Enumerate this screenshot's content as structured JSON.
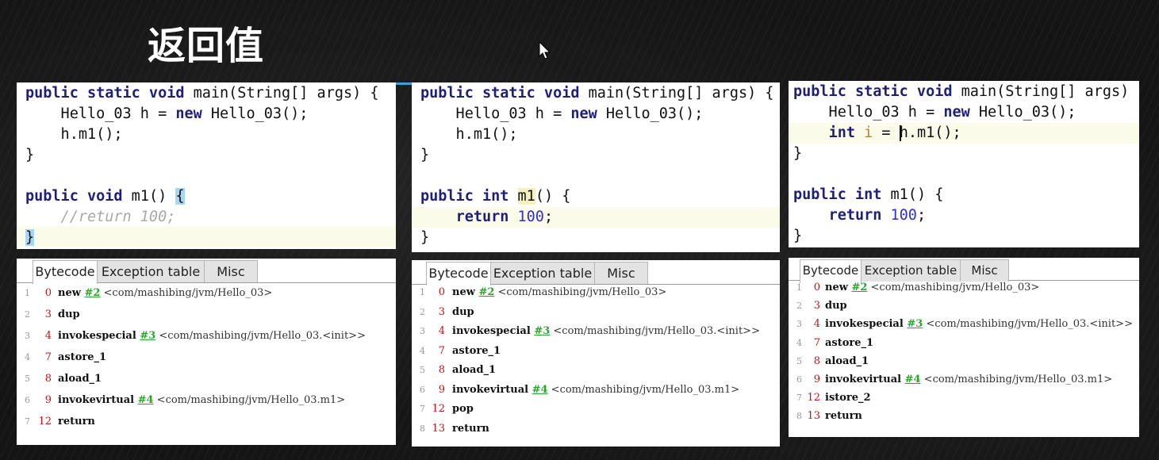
{
  "slide": {
    "title": "返回值"
  },
  "panels": [
    {
      "code": {
        "line1_kw": "public static void",
        "line1_rest": " main(String[] args) {",
        "line2_pre": "    Hello_03 h = ",
        "line2_kw": "new",
        "line2_post": " Hello_03();",
        "line3": "    h.m1();",
        "line4": "}",
        "line6_kw": "public void",
        "line6_mid": " m1() ",
        "line6_brace": "{",
        "line7": "    //return 100;",
        "line8_brace": "}"
      },
      "tabs": [
        "Bytecode",
        "Exception table",
        "Misc"
      ],
      "bytecode": [
        {
          "ln": "1",
          "off": "0",
          "op": "new",
          "ref": "#2",
          "arg": " <com/mashibing/jvm/Hello_03>"
        },
        {
          "ln": "2",
          "off": "3",
          "op": "dup",
          "ref": "",
          "arg": ""
        },
        {
          "ln": "3",
          "off": "4",
          "op": "invokespecial",
          "ref": "#3",
          "arg": " <com/mashibing/jvm/Hello_03.<init>>"
        },
        {
          "ln": "4",
          "off": "7",
          "op": "astore_1",
          "ref": "",
          "arg": ""
        },
        {
          "ln": "5",
          "off": "8",
          "op": "aload_1",
          "ref": "",
          "arg": ""
        },
        {
          "ln": "6",
          "off": "9",
          "op": "invokevirtual",
          "ref": "#4",
          "arg": " <com/mashibing/jvm/Hello_03.m1>"
        },
        {
          "ln": "7",
          "off": "12",
          "op": "return",
          "ref": "",
          "arg": ""
        }
      ]
    },
    {
      "code": {
        "line1_kw": "public static void",
        "line1_rest": " main(String[] args) {",
        "line2_pre": "    Hello_03 h = ",
        "line2_kw": "new",
        "line2_post": " Hello_03();",
        "line3": "    h.m1();",
        "line4": "}",
        "line6_kw": "public int",
        "line6_name": "m1",
        "line6_rest": "() {",
        "line7_kw": "return",
        "line7_num": "100",
        "line7_end": ";",
        "line8": "}"
      },
      "tabs": [
        "Bytecode",
        "Exception table",
        "Misc"
      ],
      "bytecode": [
        {
          "ln": "1",
          "off": "0",
          "op": "new",
          "ref": "#2",
          "arg": " <com/mashibing/jvm/Hello_03>"
        },
        {
          "ln": "2",
          "off": "3",
          "op": "dup",
          "ref": "",
          "arg": ""
        },
        {
          "ln": "3",
          "off": "4",
          "op": "invokespecial",
          "ref": "#3",
          "arg": " <com/mashibing/jvm/Hello_03.<init>>"
        },
        {
          "ln": "4",
          "off": "7",
          "op": "astore_1",
          "ref": "",
          "arg": ""
        },
        {
          "ln": "5",
          "off": "8",
          "op": "aload_1",
          "ref": "",
          "arg": ""
        },
        {
          "ln": "6",
          "off": "9",
          "op": "invokevirtual",
          "ref": "#4",
          "arg": " <com/mashibing/jvm/Hello_03.m1>"
        },
        {
          "ln": "7",
          "off": "12",
          "op": "pop",
          "ref": "",
          "arg": ""
        },
        {
          "ln": "8",
          "off": "13",
          "op": "return",
          "ref": "",
          "arg": ""
        }
      ]
    },
    {
      "code": {
        "line1_kw": "public static void",
        "line1_rest": " main(String[] args) {",
        "line2_pre": "    Hello_03 h = ",
        "line2_kw": "new",
        "line2_post": " Hello_03();",
        "line3_kw": "int",
        "line3_var": "i",
        "line3_eq": " = ",
        "line3_post": "h.m1();",
        "line4": "}",
        "line6_kw": "public int",
        "line6_rest": " m1() {",
        "line7_kw": "return",
        "line7_num": "100",
        "line7_end": ";",
        "line8": "}"
      },
      "tabs": [
        "Bytecode",
        "Exception table",
        "Misc"
      ],
      "bytecode": [
        {
          "ln": "1",
          "off": "0",
          "op": "new",
          "ref": "#2",
          "arg": " <com/mashibing/jvm/Hello_03>"
        },
        {
          "ln": "2",
          "off": "3",
          "op": "dup",
          "ref": "",
          "arg": ""
        },
        {
          "ln": "3",
          "off": "4",
          "op": "invokespecial",
          "ref": "#3",
          "arg": " <com/mashibing/jvm/Hello_03.<init>>"
        },
        {
          "ln": "4",
          "off": "7",
          "op": "astore_1",
          "ref": "",
          "arg": ""
        },
        {
          "ln": "5",
          "off": "8",
          "op": "aload_1",
          "ref": "",
          "arg": ""
        },
        {
          "ln": "6",
          "off": "9",
          "op": "invokevirtual",
          "ref": "#4",
          "arg": " <com/mashibing/jvm/Hello_03.m1>"
        },
        {
          "ln": "7",
          "off": "12",
          "op": "istore_2",
          "ref": "",
          "arg": ""
        },
        {
          "ln": "8",
          "off": "13",
          "op": "return",
          "ref": "",
          "arg": ""
        }
      ]
    }
  ]
}
